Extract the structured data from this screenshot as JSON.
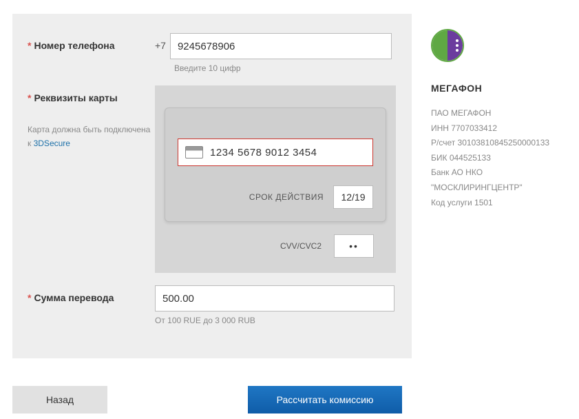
{
  "labels": {
    "phone": "Номер телефона",
    "card": "Реквизиты карты",
    "amount": "Сумма перевода"
  },
  "phone": {
    "prefix": "+7",
    "value": "9245678906",
    "helper": "Введите 10 цифр"
  },
  "card": {
    "note_prefix": "Карта должна быть подключена к ",
    "note_link": "3DSecure",
    "number": "1234 5678 9012 3454",
    "expiry_label": "СРОК ДЕЙСТВИЯ",
    "expiry": "12/19",
    "cvv_label": "CVV/CVC2",
    "cvv": "••"
  },
  "amount": {
    "value": "500.00",
    "helper": "От 100 RUE до 3 000 RUB"
  },
  "buttons": {
    "back": "Назад",
    "calc": "Рассчитать комиссию"
  },
  "side": {
    "name": "МЕГАФОН",
    "lines": [
      "ПАО МЕГАФОН",
      "ИНН 7707033412",
      "Р/счет 30103810845250000133",
      "БИК 044525133",
      "Банк АО НКО \"МОСКЛИРИНГЦЕНТР\"",
      "Код услуги 1501"
    ]
  }
}
